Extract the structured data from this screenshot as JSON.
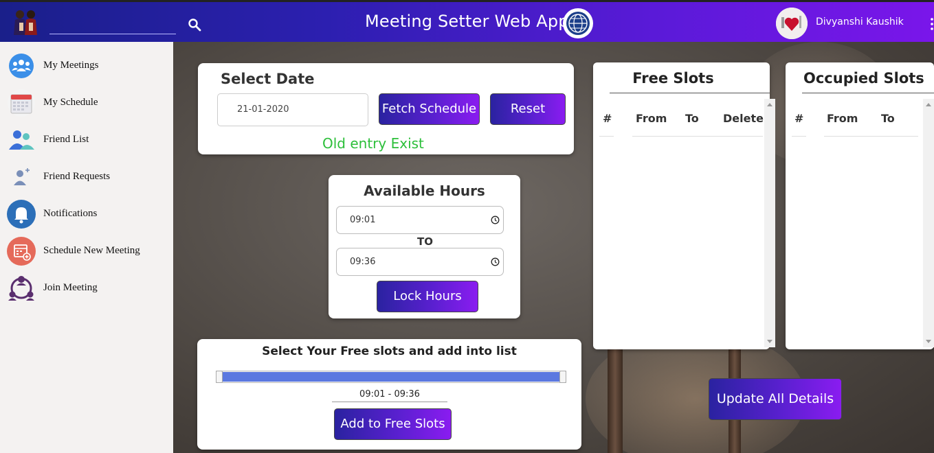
{
  "header": {
    "title": "Meeting Setter Web App",
    "search_placeholder": "",
    "user_name": "Divyanshi Kaushik",
    "gradient_start": "#1a1f8a",
    "gradient_end": "#7a16ea"
  },
  "sidebar": {
    "items": [
      {
        "label": "My Meetings",
        "icon": "group-icon"
      },
      {
        "label": "My Schedule",
        "icon": "calendar-icon"
      },
      {
        "label": "Friend List",
        "icon": "friends-icon"
      },
      {
        "label": "Friend Requests",
        "icon": "add-friend-icon"
      },
      {
        "label": "Notifications",
        "icon": "bell-icon"
      },
      {
        "label": "Schedule New Meeting",
        "icon": "calendar-add-icon"
      },
      {
        "label": "Join Meeting",
        "icon": "join-people-icon"
      }
    ]
  },
  "select_date": {
    "title": "Select Date",
    "date_value": "21-01-2020",
    "fetch_label": "Fetch Schedule",
    "reset_label": "Reset",
    "status": "Old entry Exist",
    "status_color": "#2cbf3a"
  },
  "available_hours": {
    "title": "Available Hours",
    "from": "09:01",
    "to_label": "TO",
    "to": "09:36",
    "lock_label": "Lock Hours"
  },
  "free_slot_picker": {
    "title": "Select Your Free slots and add into list",
    "range_text": "09:01 - 09:36",
    "range_start_fraction": 0.0,
    "range_end_fraction": 1.0,
    "add_label": "Add to Free Slots",
    "fill_color": "#5b78e0"
  },
  "free_slots": {
    "title": "Free Slots",
    "columns": [
      "#",
      "From",
      "To",
      "Delete"
    ],
    "rows": []
  },
  "occupied_slots": {
    "title": "Occupied Slots",
    "columns": [
      "#",
      "From",
      "To"
    ],
    "rows": []
  },
  "update_label": "Update All Details"
}
